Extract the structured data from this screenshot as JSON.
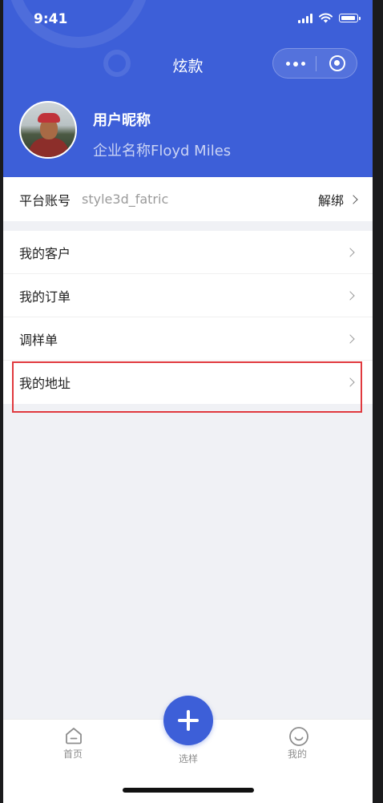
{
  "status_bar": {
    "time": "9:41"
  },
  "nav": {
    "title": "炫款"
  },
  "profile": {
    "nickname": "用户昵称",
    "company": "企业名称Floyd Miles"
  },
  "account": {
    "label": "平台账号",
    "value": "style3d_fatric",
    "action": "解绑"
  },
  "menu": {
    "items": [
      {
        "label": "我的客户"
      },
      {
        "label": "我的订单"
      },
      {
        "label": "调样单"
      },
      {
        "label": "我的地址"
      }
    ]
  },
  "tabbar": {
    "home": "首页",
    "select": "选样",
    "mine": "我的"
  },
  "colors": {
    "brand": "#3d5fd8",
    "highlight": "#e0393e"
  }
}
